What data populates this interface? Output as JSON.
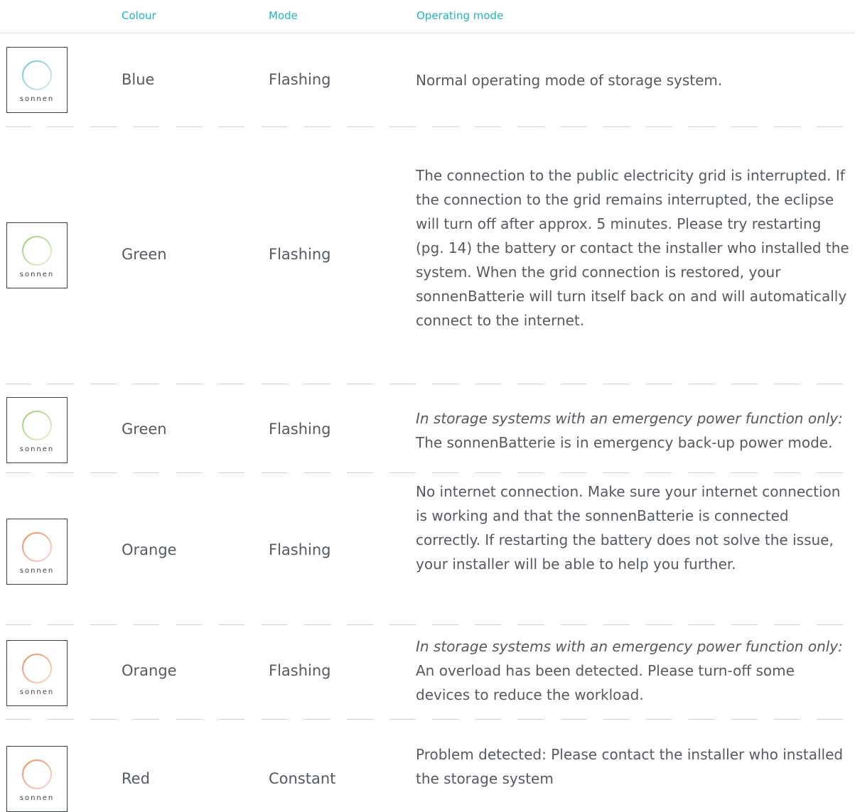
{
  "header": {
    "colour": "Colour",
    "mode": "Mode",
    "operating_mode": "Operating mode"
  },
  "brand": "sonnen",
  "accent_color": "#1fb4c6",
  "rows": [
    {
      "ring_color": "#6fc4d8",
      "colour": "Blue",
      "mode": "Flashing",
      "note": "",
      "description": "Normal operating mode of storage system."
    },
    {
      "ring_color": "#9ccd6a",
      "colour": "Green",
      "mode": "Flashing",
      "note": "",
      "description": "The connection to the public electricity grid is interrupted. If the connection to the grid remains interrupted, the eclipse will turn off after approx. 5 minutes. Please try restarting (pg. 14) the battery or contact the installer who installed the system. When the grid connection is restored, your sonnenBatterie will turn itself back on and will automatically connect to the internet."
    },
    {
      "ring_color": "#9ccd6a",
      "colour": "Green",
      "mode": "Flashing",
      "note": "In storage systems with an emergency power function only:",
      "description": "The sonnenBatterie is in emergency back-up power mode."
    },
    {
      "ring_color": "#ec8a5e",
      "colour": "Orange",
      "mode": "Flashing",
      "note": "",
      "description": "No internet connection. Make sure your internet connection is working and that the sonnenBatterie is connected correctly. If restarting the battery does not solve the issue, your installer will be able to help you further."
    },
    {
      "ring_color": "#ec8a5e",
      "colour": "Orange",
      "mode": "Flashing",
      "note": "In storage systems with an emergency power function only:",
      "description": "An overload has been detected. Please turn-off some devices to reduce the workload."
    },
    {
      "ring_color": "#ec8a5e",
      "colour": "Red",
      "mode": "Constant",
      "note": "",
      "description": "Problem detected: Please contact the installer who installed the storage system"
    }
  ]
}
